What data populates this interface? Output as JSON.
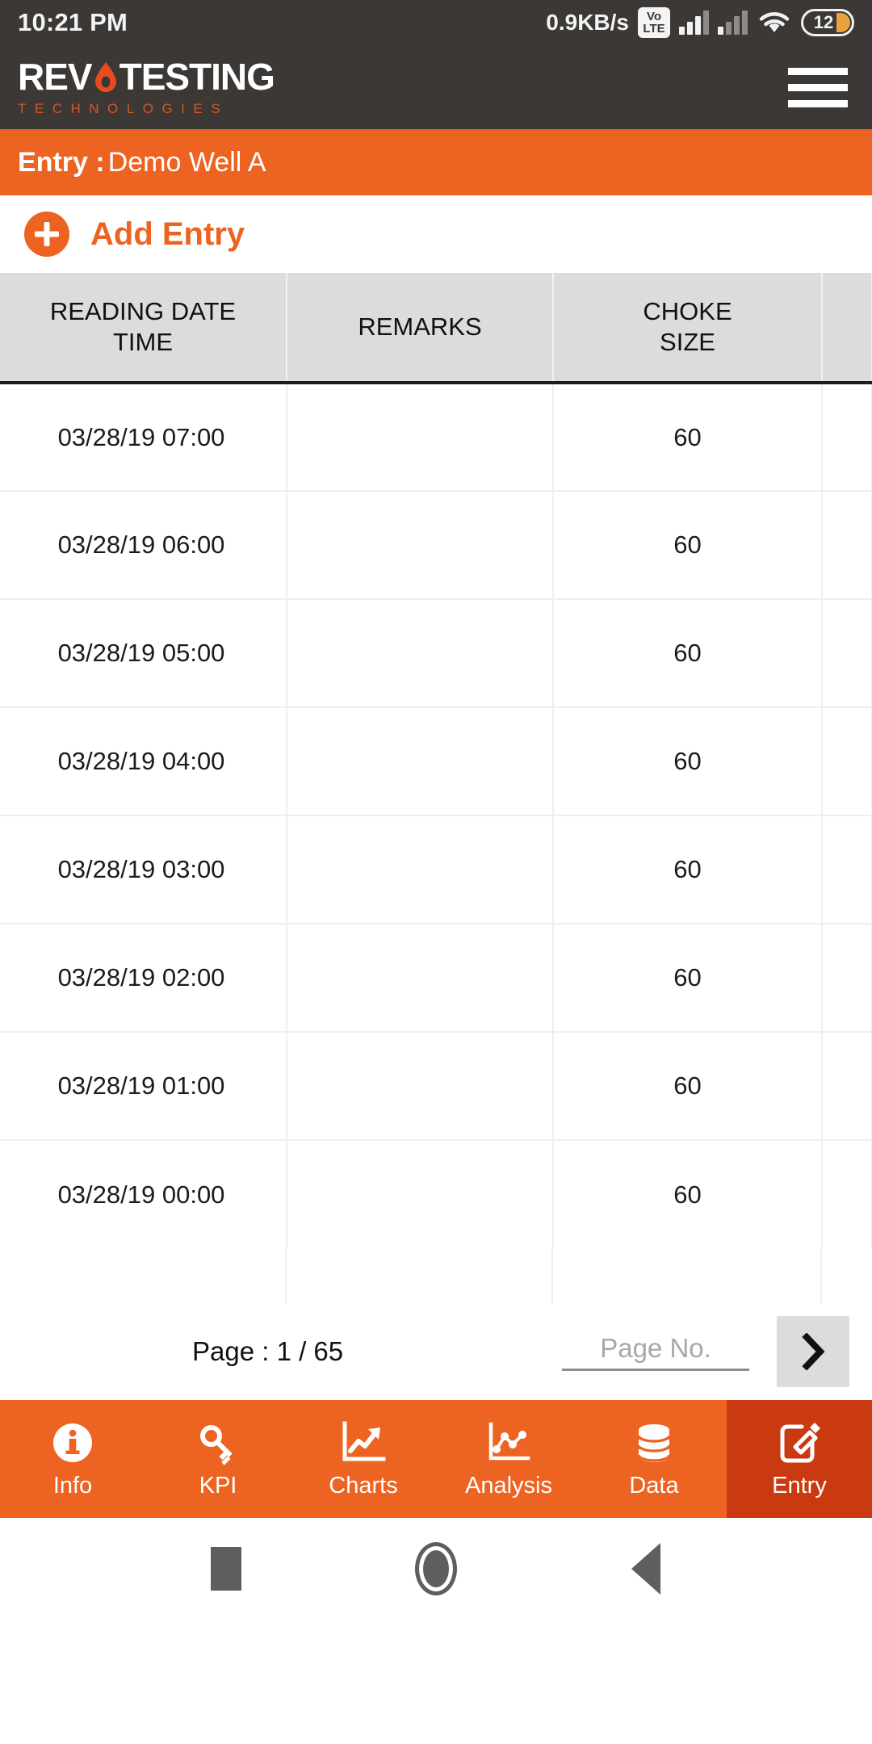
{
  "statusbar": {
    "time": "10:21 PM",
    "network_speed": "0.9KB/s",
    "volte_top": "Vo",
    "volte_bottom": "LTE",
    "battery_level": "12"
  },
  "header": {
    "logo_part1": "REV",
    "logo_part2": "TESTING",
    "logo_subtitle": "TECHNOLOGIES",
    "menu_icon": "hamburger-menu-icon"
  },
  "titlebar": {
    "label": "Entry :",
    "value": "Demo Well A"
  },
  "add_entry": {
    "label": "Add Entry",
    "icon": "plus-circle-icon"
  },
  "table": {
    "columns": [
      "READING DATE TIME",
      "REMARKS",
      "CHOKE SIZE",
      ""
    ],
    "column_lines": [
      [
        "READING DATE",
        "TIME"
      ],
      [
        "REMARKS"
      ],
      [
        "CHOKE",
        "SIZE"
      ],
      [
        ""
      ]
    ],
    "rows": [
      {
        "date_time": "03/28/19 07:00",
        "remarks": "",
        "choke_size": "60",
        "extra": ""
      },
      {
        "date_time": "03/28/19 06:00",
        "remarks": "",
        "choke_size": "60",
        "extra": ""
      },
      {
        "date_time": "03/28/19 05:00",
        "remarks": "",
        "choke_size": "60",
        "extra": ""
      },
      {
        "date_time": "03/28/19 04:00",
        "remarks": "",
        "choke_size": "60",
        "extra": ""
      },
      {
        "date_time": "03/28/19 03:00",
        "remarks": "",
        "choke_size": "60",
        "extra": ""
      },
      {
        "date_time": "03/28/19 02:00",
        "remarks": "",
        "choke_size": "60",
        "extra": ""
      },
      {
        "date_time": "03/28/19 01:00",
        "remarks": "",
        "choke_size": "60",
        "extra": ""
      },
      {
        "date_time": "03/28/19 00:00",
        "remarks": "",
        "choke_size": "60",
        "extra": ""
      }
    ]
  },
  "pagination": {
    "page_info": "Page : 1 / 65",
    "current_page": "1",
    "total_pages": "65",
    "input_value": "",
    "input_placeholder": "Page No.",
    "next_icon": "chevron-right-icon"
  },
  "bottom_nav": {
    "items": [
      {
        "label": "Info",
        "icon": "info-circle-icon",
        "active": false
      },
      {
        "label": "KPI",
        "icon": "key-icon",
        "active": false
      },
      {
        "label": "Charts",
        "icon": "line-chart-icon",
        "active": false
      },
      {
        "label": "Analysis",
        "icon": "scatter-plot-icon",
        "active": false
      },
      {
        "label": "Data",
        "icon": "database-icon",
        "active": false
      },
      {
        "label": "Entry",
        "icon": "edit-square-icon",
        "active": true
      }
    ]
  },
  "android_nav": {
    "recents": "square-recents-icon",
    "home": "circle-home-icon",
    "back": "triangle-back-icon"
  },
  "colors": {
    "accent_orange": "#ED6322",
    "active_tab": "#C93A11",
    "header_dark": "#3B3835",
    "table_header": "#DCDCDC",
    "battery_amber": "#E8A33D"
  }
}
